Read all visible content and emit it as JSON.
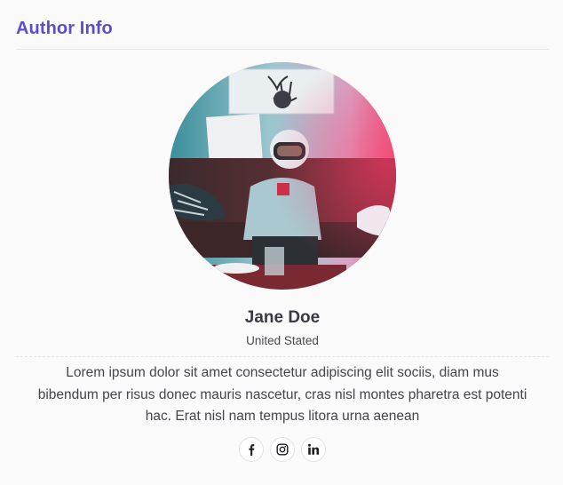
{
  "section": {
    "title": "Author Info"
  },
  "author": {
    "name": "Jane Doe",
    "location": "United Stated",
    "bio": "Lorem ipsum dolor sit amet consectetur adipiscing elit sociis, diam mus bibendum per risus donec mauris nascetur, cras nisl montes pharetra est potenti hac. Erat nisl nam tempus litora urna aenean"
  },
  "social_links": [
    {
      "icon": "facebook-icon"
    },
    {
      "icon": "instagram-icon"
    },
    {
      "icon": "linkedin-icon"
    }
  ],
  "colors": {
    "title": "#5b4fc8",
    "text": "#3a3a44",
    "background": "#fafafa"
  }
}
